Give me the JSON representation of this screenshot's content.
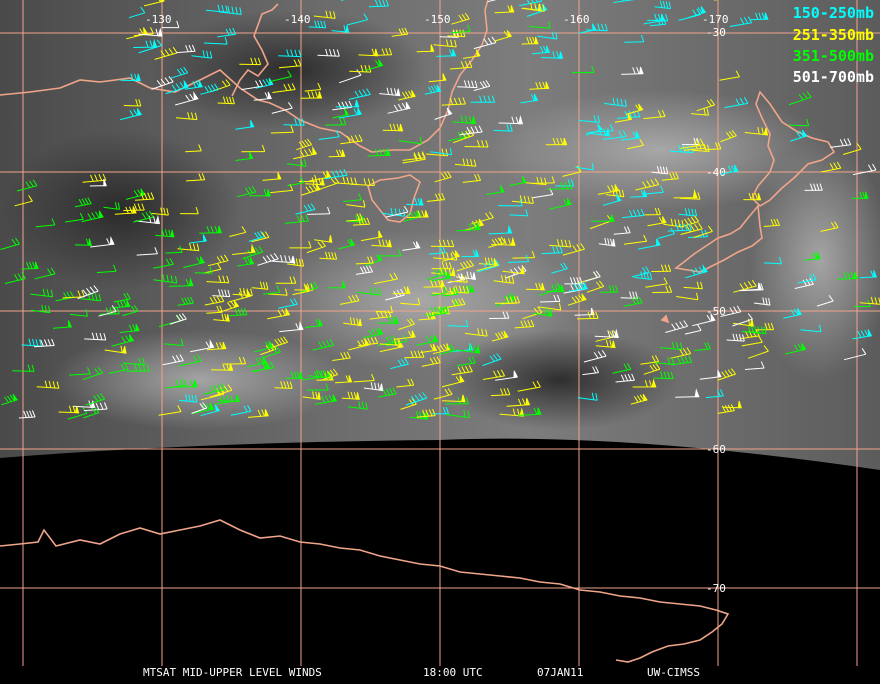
{
  "map": {
    "satellite_view": "water vapor imagery, grayscale",
    "colors": {
      "coast": "#f0a58a",
      "grid": "#f0a58a",
      "space": "#000000"
    },
    "longitude_labels": [
      "-130",
      "-140",
      "-150",
      "-160",
      "-170"
    ],
    "latitude_labels": [
      "-30",
      "-40",
      "-50",
      "-60",
      "-70"
    ]
  },
  "legend": {
    "items": [
      {
        "label": "150-250mb",
        "color": "#00ffff"
      },
      {
        "label": "251-350mb",
        "color": "#ffff00"
      },
      {
        "label": "351-500mb",
        "color": "#00ff00"
      },
      {
        "label": "501-700mb",
        "color": "#ffffff"
      }
    ]
  },
  "footer": {
    "product": "MTSAT MID-UPPER LEVEL WINDS",
    "time": "18:00 UTC",
    "date": "07JAN11",
    "source": "UW-CIMSS"
  }
}
